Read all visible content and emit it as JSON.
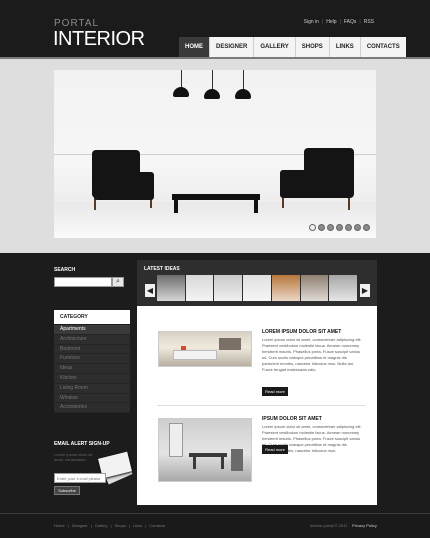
{
  "header": {
    "logo_small": "PORTAL",
    "logo_big": "INTERIOR",
    "top_links": [
      "Sign in",
      "Help",
      "FAQs",
      "RSS"
    ],
    "nav": [
      "HOME",
      "DESIGNER",
      "GALLERY",
      "SHOPS",
      "LINKS",
      "CONTACTS"
    ],
    "nav_active_index": 0
  },
  "hero": {
    "slide_count": 7,
    "active_slide": 0
  },
  "sidebar": {
    "search_title": "SEARCH",
    "search_icon": "magnifier-icon",
    "category_title": "CATEGORY",
    "categories": [
      "Apartments",
      "Architecture",
      "Bedroom",
      "Furniture",
      "Ideas",
      "Kitchen",
      "Living Room",
      "Window",
      "Accessories"
    ],
    "active_category": 0,
    "alert_title": "EMAIL ALERT SIGN-UP",
    "alert_text": "Lorem ipsum dolor sit amet, consectetur",
    "alert_placeholder": "Enter your e-mail please",
    "alert_button": "Subscribe"
  },
  "ideas": {
    "title": "LATEST IDEAS",
    "prev_icon": "arrow-left-icon",
    "next_icon": "arrow-right-icon",
    "thumb_colors": [
      "#6d6d6d",
      "#d8d8d8",
      "#c9c9c9",
      "#e0e0e0",
      "#b8763a",
      "#8f8070",
      "#a6a6a6"
    ]
  },
  "articles": [
    {
      "title": "LOREM IPSUM DOLOR SIT AMET",
      "body": "Lorem ipsum dolor sit amet, consectetuer adipiscing elit. Praesent vestibulum molestie lacus. Aenean nonummy hendrerit mauris. Phasellus porta. Fusce suscipit varius mi. Cum sociis natoque penatibus et magnis dis parturient montes, nascetur ridiculus mus. Nulla dui. Fusce feugiat malesuada odio.",
      "button": "Read more"
    },
    {
      "title": "IPSUM DOLOR SIT AMET",
      "body": "Lorem ipsum dolor sit amet, consectetuer adipiscing elit. Praesent vestibulum molestie lacus. Aenean nonummy hendrerit mauris. Phasellus porta. Fusce suscipit varius mi. Cum sociis natoque penatibus et magnis dis parturient montes, nascetur ridiculus mus.",
      "button": "Read more"
    }
  ],
  "footer": {
    "links": [
      "Home",
      "Designer",
      "Gallery",
      "Shops",
      "Links",
      "Contacts"
    ],
    "copyright": "Interior portal © 2011",
    "privacy": "Privacy Policy"
  }
}
